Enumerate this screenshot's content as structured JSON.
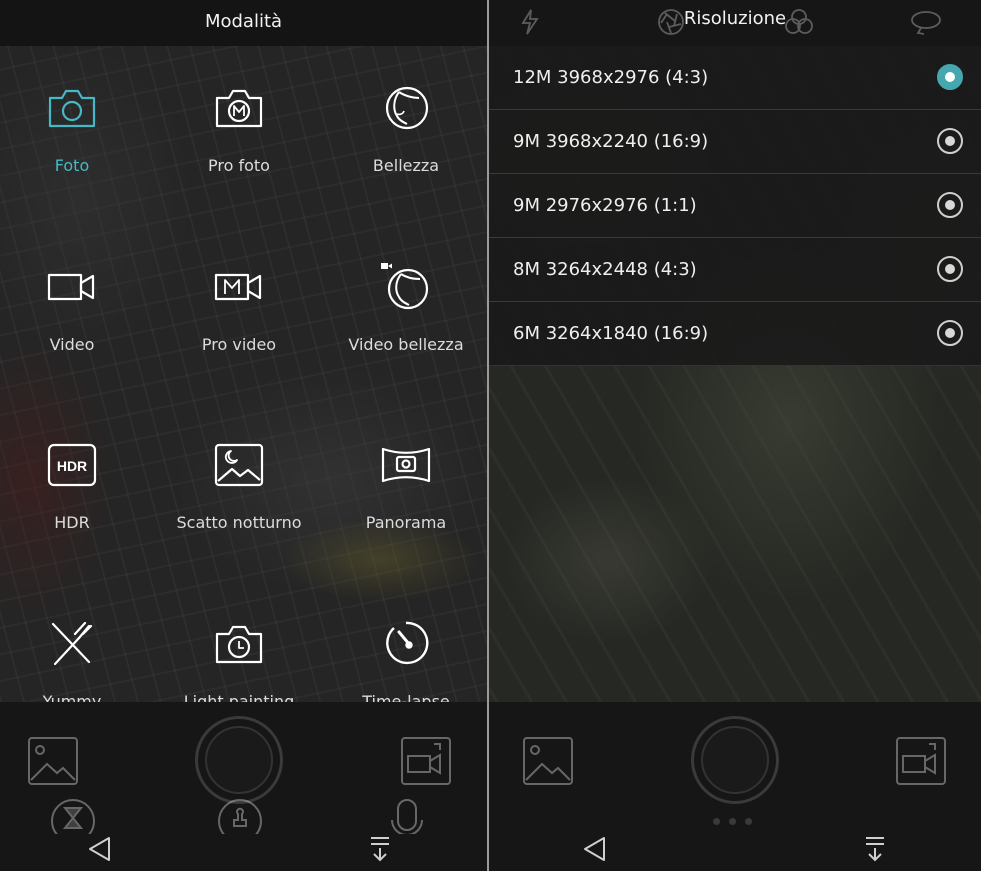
{
  "colors": {
    "accent": "#45b9c5",
    "radio_selected": "#45a7b0"
  },
  "mode_panel": {
    "title": "Modalità",
    "modes": [
      {
        "label": "Foto",
        "icon": "camera-icon",
        "active": true
      },
      {
        "label": "Pro foto",
        "icon": "pro-camera-icon"
      },
      {
        "label": "Bellezza",
        "icon": "beauty-face-icon"
      },
      {
        "label": "Video",
        "icon": "video-camera-icon"
      },
      {
        "label": "Pro video",
        "icon": "pro-video-icon"
      },
      {
        "label": "Video bellezza",
        "icon": "beauty-video-icon"
      },
      {
        "label": "HDR",
        "icon": "hdr-icon",
        "icon_text": "HDR"
      },
      {
        "label": "Scatto notturno",
        "icon": "night-shot-icon"
      },
      {
        "label": "Panorama",
        "icon": "panorama-icon"
      },
      {
        "label": "Yummy",
        "icon": "fork-knife-icon"
      },
      {
        "label": "Light painting",
        "icon": "light-painting-icon"
      },
      {
        "label": "Time-lapse",
        "icon": "time-lapse-icon"
      }
    ],
    "bottom_icons": [
      "gallery-icon",
      "shutter-button",
      "switch-camera-icon",
      "timer-icon",
      "stamp-icon",
      "microphone-icon"
    ],
    "nav": [
      "back-icon",
      "notification-pull-icon"
    ]
  },
  "resolution_panel": {
    "title": "Risoluzione",
    "options": [
      {
        "label": "12M 3968x2976 (4:3)",
        "selected": true
      },
      {
        "label": "9M 3968x2240 (16:9)",
        "selected": false
      },
      {
        "label": "9M 2976x2976 (1:1)",
        "selected": false
      },
      {
        "label": "8M 3264x2448 (4:3)",
        "selected": false
      },
      {
        "label": "6M 3264x1840 (16:9)",
        "selected": false
      }
    ],
    "header_icons": [
      "flash-auto-icon",
      "aperture-icon",
      "filter-icon",
      "rotate-icon"
    ]
  }
}
